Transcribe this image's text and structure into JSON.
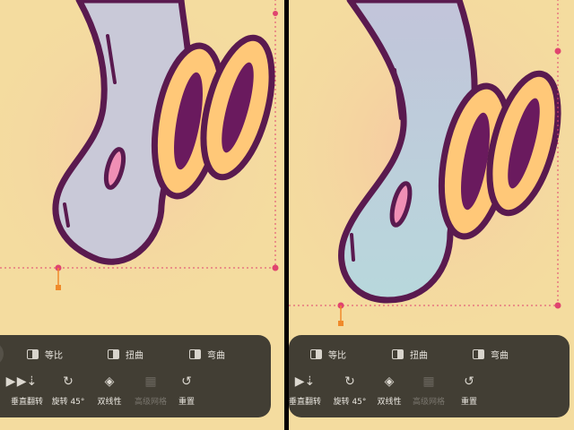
{
  "toolbar": {
    "modes": [
      {
        "label": "等比",
        "icon": "uniform-scale-icon"
      },
      {
        "label": "扭曲",
        "icon": "distort-icon"
      },
      {
        "label": "弯曲",
        "icon": "warp-icon"
      }
    ],
    "tools": [
      {
        "label": "垂直翻转",
        "icon": "flip-vertical-icon"
      },
      {
        "label": "旋转 45°",
        "icon": "rotate-45-icon"
      },
      {
        "label": "双线性",
        "icon": "bilinear-icon"
      },
      {
        "label": "高级网格",
        "icon": "advanced-mesh-icon",
        "enabled": false
      },
      {
        "label": "重置",
        "icon": "reset-icon"
      }
    ]
  },
  "colors": {
    "canvas_bg": "#f4dc9f",
    "outline": "#5a1a4f",
    "handle": "#e0446f",
    "anchor": "#f08a2a",
    "toolbar_bg": "#34312c"
  }
}
